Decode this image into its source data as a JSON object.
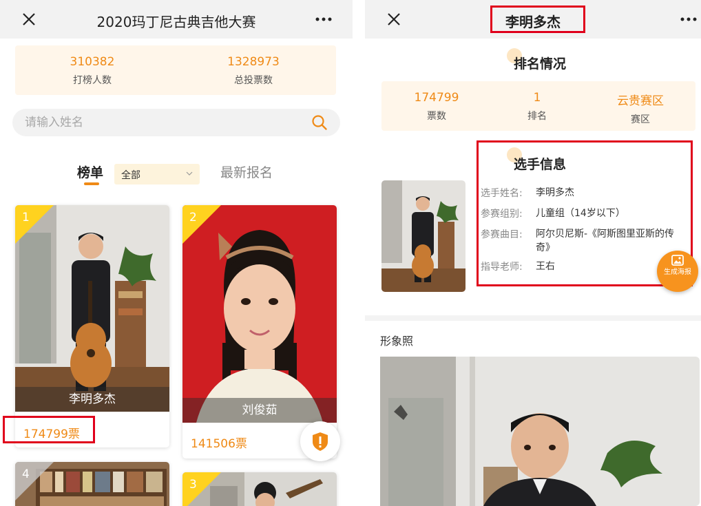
{
  "left": {
    "title": "2020玛丁尼古典吉他大赛",
    "stats": {
      "participants": "310382",
      "participants_label": "打榜人数",
      "total_votes": "1328973",
      "total_votes_label": "总投票数"
    },
    "search_placeholder": "请输入姓名",
    "tabs": {
      "rank": "榜单",
      "filter": "全部",
      "latest": "最新报名"
    },
    "cards": [
      {
        "rank": "1",
        "name": "李明多杰",
        "votes": "174799票"
      },
      {
        "rank": "2",
        "name": "刘俊茹",
        "votes": "141506票"
      },
      {
        "rank": "4"
      },
      {
        "rank": "3"
      }
    ]
  },
  "right": {
    "title": "李明多杰",
    "ranking_title": "排名情况",
    "ranking": [
      {
        "value": "174799",
        "label": "票数"
      },
      {
        "value": "1",
        "label": "排名"
      },
      {
        "value": "云贵赛区",
        "label": "赛区"
      }
    ],
    "info_title": "选手信息",
    "info": [
      {
        "key": "选手姓名:",
        "value": "李明多杰"
      },
      {
        "key": "参赛组别:",
        "value": "儿童组（14岁以下）"
      },
      {
        "key": "参赛曲目:",
        "value": "阿尔贝尼斯-《阿斯图里亚斯的传奇》"
      },
      {
        "key": "指导老师:",
        "value": "王右"
      }
    ],
    "poster_button": "生成海报",
    "image_section": "形象照"
  },
  "colors": {
    "accent": "#ef8a16",
    "badge_yellow": "#ffd21f",
    "highlight_red": "#e0001b",
    "stats_bg": "#fff6ea"
  }
}
